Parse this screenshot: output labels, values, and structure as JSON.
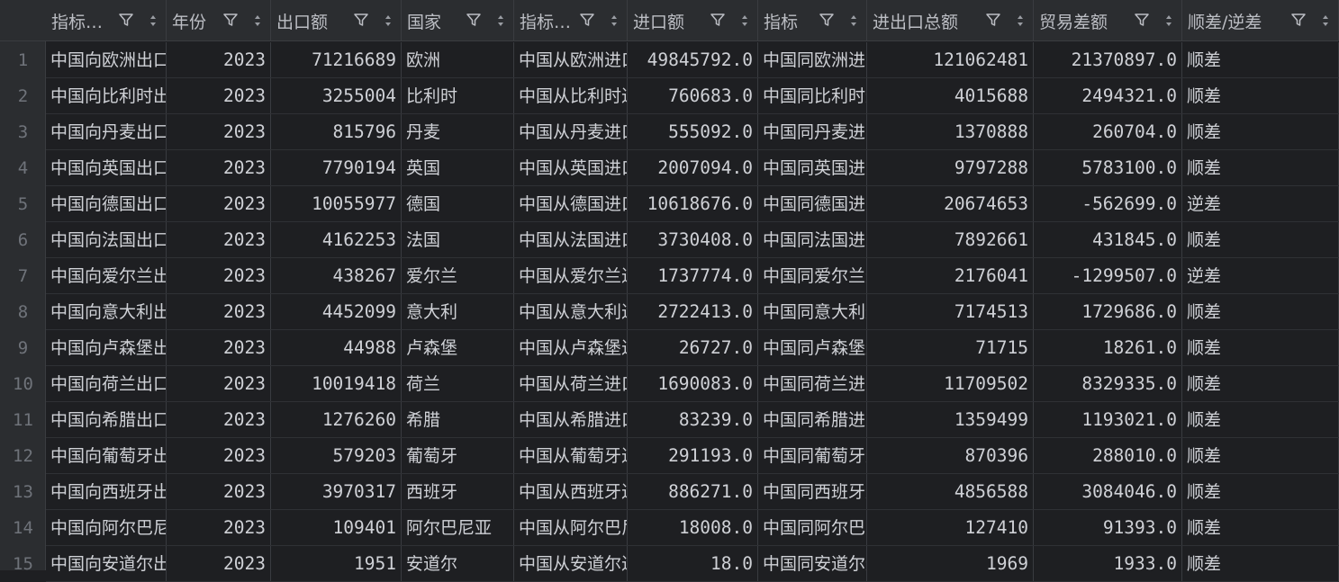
{
  "columns": [
    {
      "label": "指标…"
    },
    {
      "label": "年份"
    },
    {
      "label": "出口额"
    },
    {
      "label": "国家"
    },
    {
      "label": "指标…"
    },
    {
      "label": "进口额"
    },
    {
      "label": "指标"
    },
    {
      "label": "进出口总额"
    },
    {
      "label": "贸易差额"
    },
    {
      "label": "顺差/逆差"
    }
  ],
  "rows": [
    {
      "num": "1",
      "cells": [
        "中国向欧洲出口",
        "2023",
        "71216689",
        "欧洲",
        "中国从欧洲进口",
        "49845792.0",
        "中国同欧洲进出口",
        "121062481",
        "21370897.0",
        "顺差"
      ]
    },
    {
      "num": "2",
      "cells": [
        "中国向比利时出口",
        "2023",
        "3255004",
        "比利时",
        "中国从比利时进口",
        "760683.0",
        "中国同比利时进出口",
        "4015688",
        "2494321.0",
        "顺差"
      ]
    },
    {
      "num": "3",
      "cells": [
        "中国向丹麦出口",
        "2023",
        "815796",
        "丹麦",
        "中国从丹麦进口",
        "555092.0",
        "中国同丹麦进出口",
        "1370888",
        "260704.0",
        "顺差"
      ]
    },
    {
      "num": "4",
      "cells": [
        "中国向英国出口",
        "2023",
        "7790194",
        "英国",
        "中国从英国进口",
        "2007094.0",
        "中国同英国进出口",
        "9797288",
        "5783100.0",
        "顺差"
      ]
    },
    {
      "num": "5",
      "cells": [
        "中国向德国出口",
        "2023",
        "10055977",
        "德国",
        "中国从德国进口",
        "10618676.0",
        "中国同德国进出口",
        "20674653",
        "-562699.0",
        "逆差"
      ]
    },
    {
      "num": "6",
      "cells": [
        "中国向法国出口",
        "2023",
        "4162253",
        "法国",
        "中国从法国进口",
        "3730408.0",
        "中国同法国进出口",
        "7892661",
        "431845.0",
        "顺差"
      ]
    },
    {
      "num": "7",
      "cells": [
        "中国向爱尔兰出口",
        "2023",
        "438267",
        "爱尔兰",
        "中国从爱尔兰进口",
        "1737774.0",
        "中国同爱尔兰进出口",
        "2176041",
        "-1299507.0",
        "逆差"
      ]
    },
    {
      "num": "8",
      "cells": [
        "中国向意大利出口",
        "2023",
        "4452099",
        "意大利",
        "中国从意大利进口",
        "2722413.0",
        "中国同意大利进出口",
        "7174513",
        "1729686.0",
        "顺差"
      ]
    },
    {
      "num": "9",
      "cells": [
        "中国向卢森堡出口",
        "2023",
        "44988",
        "卢森堡",
        "中国从卢森堡进口",
        "26727.0",
        "中国同卢森堡进出口",
        "71715",
        "18261.0",
        "顺差"
      ]
    },
    {
      "num": "10",
      "cells": [
        "中国向荷兰出口",
        "2023",
        "10019418",
        "荷兰",
        "中国从荷兰进口",
        "1690083.0",
        "中国同荷兰进出口",
        "11709502",
        "8329335.0",
        "顺差"
      ]
    },
    {
      "num": "11",
      "cells": [
        "中国向希腊出口",
        "2023",
        "1276260",
        "希腊",
        "中国从希腊进口",
        "83239.0",
        "中国同希腊进出口",
        "1359499",
        "1193021.0",
        "顺差"
      ]
    },
    {
      "num": "12",
      "cells": [
        "中国向葡萄牙出口",
        "2023",
        "579203",
        "葡萄牙",
        "中国从葡萄牙进口",
        "291193.0",
        "中国同葡萄牙进出口",
        "870396",
        "288010.0",
        "顺差"
      ]
    },
    {
      "num": "13",
      "cells": [
        "中国向西班牙出口",
        "2023",
        "3970317",
        "西班牙",
        "中国从西班牙进口",
        "886271.0",
        "中国同西班牙进出口",
        "4856588",
        "3084046.0",
        "顺差"
      ]
    },
    {
      "num": "14",
      "cells": [
        "中国向阿尔巴尼亚出口",
        "2023",
        "109401",
        "阿尔巴尼亚",
        "中国从阿尔巴尼亚进口",
        "18008.0",
        "中国同阿尔巴尼亚进出口",
        "127410",
        "91393.0",
        "顺差"
      ]
    },
    {
      "num": "15",
      "cells": [
        "中国向安道尔出口",
        "2023",
        "1951",
        "安道尔",
        "中国从安道尔进口",
        "18.0",
        "中国同安道尔进出口",
        "1969",
        "1933.0",
        "顺差"
      ]
    }
  ]
}
